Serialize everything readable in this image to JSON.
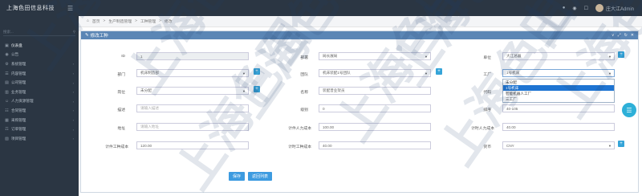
{
  "app": {
    "title": "上海色田信息科技"
  },
  "topbar": {
    "menu_icon": "hamburger-icon",
    "user_name": "庄大江Admin"
  },
  "sidebar": {
    "search_placeholder": "搜索...",
    "items": [
      {
        "label": "仪表盘",
        "icon": "dashboard-icon"
      },
      {
        "label": "公告",
        "icon": "notice-icon"
      },
      {
        "label": "系统管理",
        "icon": "gear-icon"
      },
      {
        "label": "内容管理",
        "icon": "doc-icon"
      },
      {
        "label": "公司管理",
        "icon": "building-icon"
      },
      {
        "label": "业务管理",
        "icon": "briefcase-icon"
      },
      {
        "label": "人力资源管理",
        "icon": "people-icon"
      },
      {
        "label": "合同管理",
        "icon": "contract-icon"
      },
      {
        "label": "采购管理",
        "icon": "cart-icon"
      },
      {
        "label": "订单管理",
        "icon": "order-icon"
      },
      {
        "label": "项目管理",
        "icon": "project-icon"
      }
    ]
  },
  "breadcrumb": [
    "首页",
    "生产制造管理",
    "工种管理",
    "修改"
  ],
  "panel": {
    "title": "修改工种"
  },
  "form": {
    "id_label": "ID",
    "id_value": "1",
    "group_label": "部署",
    "group_value": "局长展局",
    "unit_label": "单位",
    "unit_value": "大江总器",
    "dept_label": "部门",
    "dept_value": "机床制造部",
    "team_label": "团队",
    "team_value": "机床装配1号团队",
    "factory_label": "工厂",
    "factory_value": "1号机床",
    "post_label": "岗位",
    "post_value": "未分配",
    "name_label": "名称",
    "name_value": "装配普业架员",
    "code_label": "代码",
    "code_value": "",
    "desc_label": "描述",
    "desc_placeholder": "请输入描述",
    "level_label": "级别",
    "level_value": "0",
    "sort_label": "排序",
    "sort_value": "40-105",
    "addr_label": "地址",
    "addr_placeholder": "请输入地址",
    "hour_cost_label": "计件人力成本",
    "hour_cost_value": "100.00",
    "time_cost_label": "计时人力成本",
    "time_cost_value": "40.00",
    "piece_cost_label": "计件工种成本",
    "piece_cost_value": "120.00",
    "time_work_cost_label": "计时工种成本",
    "time_work_cost_value": "40.00",
    "currency_label": "货币",
    "currency_value": "CNY"
  },
  "factory_options": [
    "未分配",
    "1号机床",
    "智能机器人工厂",
    "三工厂"
  ],
  "factory_selected_index": 1,
  "buttons": {
    "save": "保存",
    "back": "返回列表"
  },
  "watermark": "上海色田"
}
